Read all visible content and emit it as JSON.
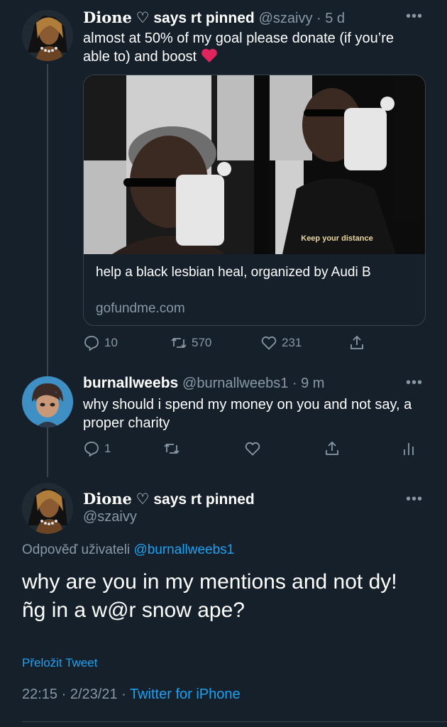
{
  "tweet1": {
    "display_name": "Dione",
    "name_suffix": "says rt pinned",
    "handle": "@szaivy",
    "time": "5 d",
    "text": "almost at 50% of my goal please donate (if you’re able to) and boost",
    "card": {
      "image_caption": "Keep your distance",
      "title": "help a black lesbian heal, organized by Audi B",
      "domain": "gofundme.com"
    },
    "actions": {
      "replies": "10",
      "retweets": "570",
      "likes": "231"
    }
  },
  "tweet2": {
    "display_name": "burnallweebs",
    "handle": "@burnallweebs1",
    "time": "9 m",
    "text": "why should i spend my money on you and not say, a proper charity",
    "actions": {
      "replies": "1"
    }
  },
  "tweet3": {
    "display_name": "Dione",
    "name_suffix": "says rt pinned",
    "handle": "@szaivy",
    "reply_prefix": "Odpověď uživateli",
    "reply_to": "@burnallweebs1",
    "text": "why are you in my mentions and not dy! ñg in a w@r snow ape?",
    "translate": "Přeložit Tweet",
    "time": "22:15",
    "date": "2/23/21",
    "source": "Twitter for iPhone"
  },
  "icons": {
    "heart_emoji": "red-heart-emoji",
    "reply": "reply-icon",
    "retweet": "retweet-icon",
    "like": "heart-icon",
    "share": "share-icon",
    "analytics": "analytics-icon",
    "more": "more-icon"
  },
  "colors": {
    "background": "#15202b",
    "text_secondary": "#8899a6",
    "link": "#1da1f2",
    "border": "#38444d",
    "emoji_heart": "#e0245e"
  }
}
